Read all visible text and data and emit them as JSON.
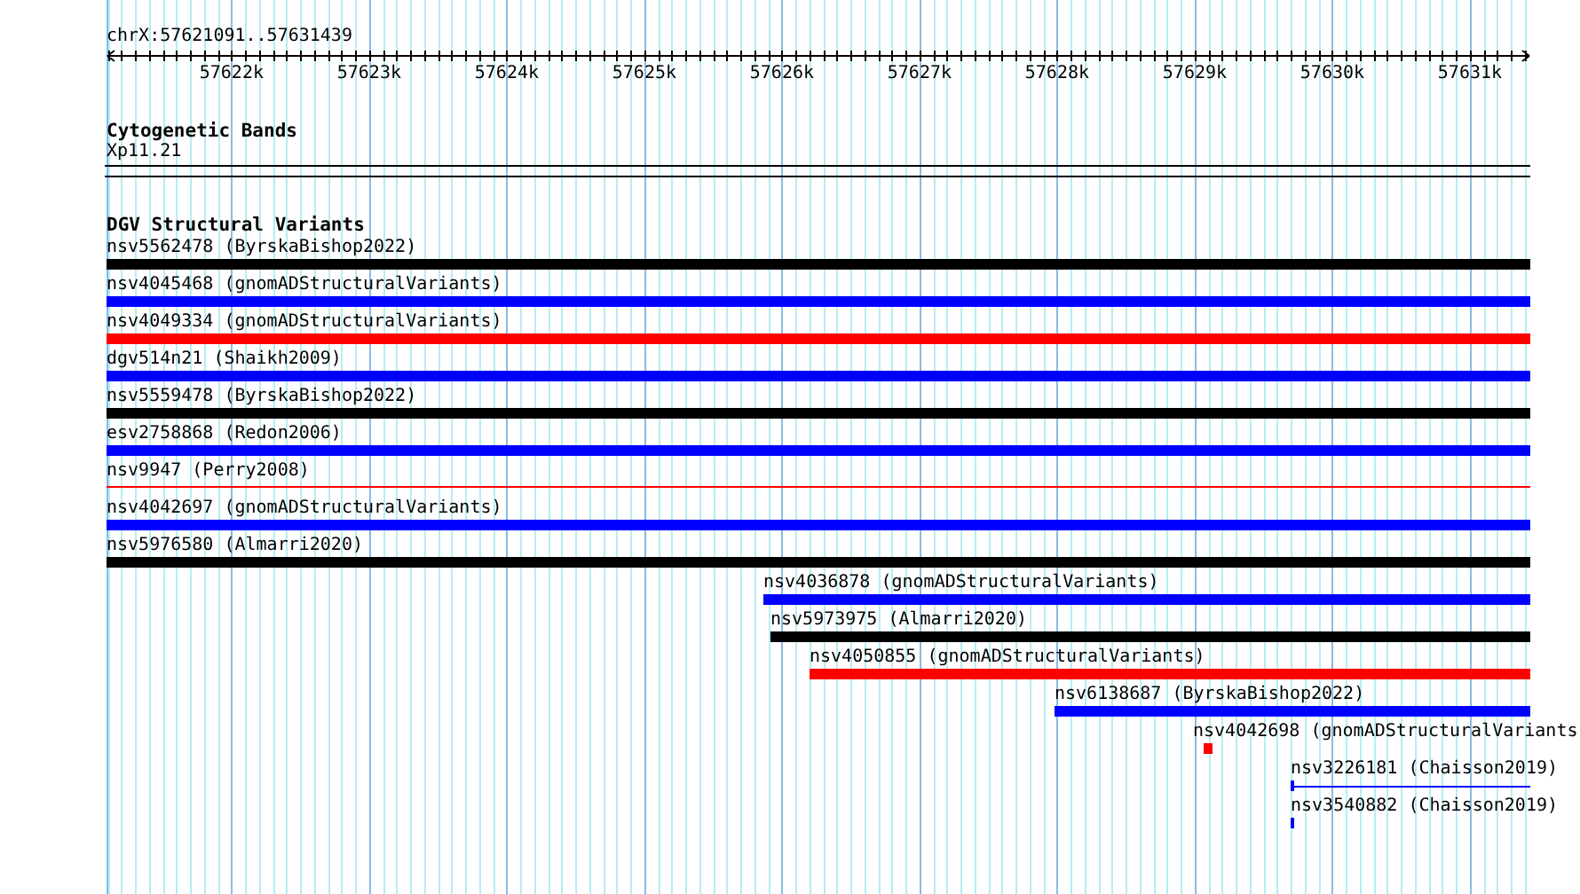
{
  "locus": "chrX:57621091..57631439",
  "ruler": {
    "labels": [
      "57622k",
      "57623k",
      "57624k",
      "57625k",
      "57626k",
      "57627k",
      "57628k",
      "57629k",
      "57630k",
      "57631k"
    ]
  },
  "cytogenetic_bands": {
    "title": "Cytogenetic Bands",
    "band": "Xp11.21"
  },
  "dgv_track": {
    "title": "DGV Structural Variants",
    "features": [
      {
        "label": "nsv5562478 (ByrskaBishop2022)",
        "kind": "bar",
        "color": "#000000"
      },
      {
        "label": "nsv4045468 (gnomADStructuralVariants)",
        "kind": "bar",
        "color": "#0000ff"
      },
      {
        "label": "nsv4049334 (gnomADStructuralVariants)",
        "kind": "bar",
        "color": "#ff0000"
      },
      {
        "label": "dgv514n21 (Shaikh2009)",
        "kind": "bar",
        "color": "#0000ff"
      },
      {
        "label": "nsv5559478 (ByrskaBishop2022)",
        "kind": "bar",
        "color": "#000000"
      },
      {
        "label": "esv2758868 (Redon2006)",
        "kind": "bar",
        "color": "#0000ff"
      },
      {
        "label": "nsv9947 (Perry2008)",
        "kind": "line",
        "color": "#ff0000"
      },
      {
        "label": "nsv4042697 (gnomADStructuralVariants)",
        "kind": "bar",
        "color": "#0000ff"
      },
      {
        "label": "nsv5976580 (Almarri2020)",
        "kind": "bar",
        "color": "#000000"
      },
      {
        "label": "nsv4036878 (gnomADStructuralVariants)",
        "kind": "bar",
        "color": "#0000ff"
      },
      {
        "label": "nsv5973975 (Almarri2020)",
        "kind": "bar",
        "color": "#000000"
      },
      {
        "label": "nsv4050855 (gnomADStructuralVariants)",
        "kind": "bar",
        "color": "#ff0000"
      },
      {
        "label": "nsv6138687 (ByrskaBishop2022)",
        "kind": "bar",
        "color": "#0000ff"
      },
      {
        "label": "nsv4042698 (gnomADStructuralVariants",
        "kind": "bar",
        "color": "#ff0000"
      },
      {
        "label": "nsv3226181 (Chaisson2019)",
        "kind": "marker_line",
        "color": "#0000ff"
      },
      {
        "label": "nsv3540882 (Chaisson2019)",
        "kind": "bar",
        "color": "#0000ff"
      }
    ]
  }
}
